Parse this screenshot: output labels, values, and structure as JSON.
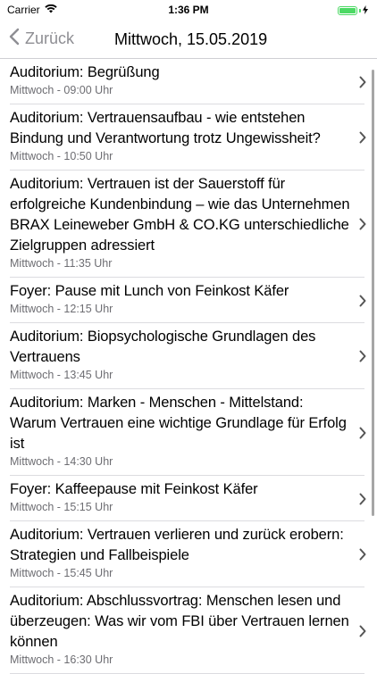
{
  "status_bar": {
    "carrier": "Carrier",
    "time": "1:36 PM"
  },
  "nav": {
    "back_label": "Zurück",
    "title": "Mittwoch, 15.05.2019"
  },
  "colors": {
    "back_tint": "#8e8e93",
    "battery": "#4cd964",
    "subtitle": "#6d6d72"
  },
  "sessions": [
    {
      "title": "Auditorium: Begrüßung",
      "time": "Mittwoch - 09:00 Uhr"
    },
    {
      "title": "Auditorium: Vertrauensaufbau - wie entstehen Bindung und Verantwortung trotz Ungewissheit?",
      "time": "Mittwoch - 10:50 Uhr"
    },
    {
      "title": "Auditorium: Vertrauen ist der Sauerstoff für erfolgreiche Kundenbindung – wie das Unternehmen BRAX Leineweber GmbH & CO.KG unterschiedliche Zielgruppen adressiert",
      "time": "Mittwoch - 11:35 Uhr"
    },
    {
      "title": "Foyer: Pause mit Lunch von Feinkost Käfer",
      "time": "Mittwoch - 12:15 Uhr"
    },
    {
      "title": "Auditorium: Biopsychologische Grundlagen des Vertrauens",
      "time": "Mittwoch - 13:45 Uhr"
    },
    {
      "title": "Auditorium: Marken - Menschen - Mittelstand: Warum Vertrauen eine wichtige Grundlage für Erfolg ist",
      "time": "Mittwoch - 14:30 Uhr"
    },
    {
      "title": "Foyer: Kaffeepause mit Feinkost Käfer",
      "time": "Mittwoch - 15:15 Uhr"
    },
    {
      "title": "Auditorium: Vertrauen verlieren und zurück erobern: Strategien und Fallbeispiele",
      "time": "Mittwoch - 15:45 Uhr"
    },
    {
      "title": "Auditorium: Abschlussvortrag: Menschen lesen und überzeugen: Was wir vom FBI über Vertrauen lernen können",
      "time": "Mittwoch - 16:30 Uhr"
    }
  ]
}
